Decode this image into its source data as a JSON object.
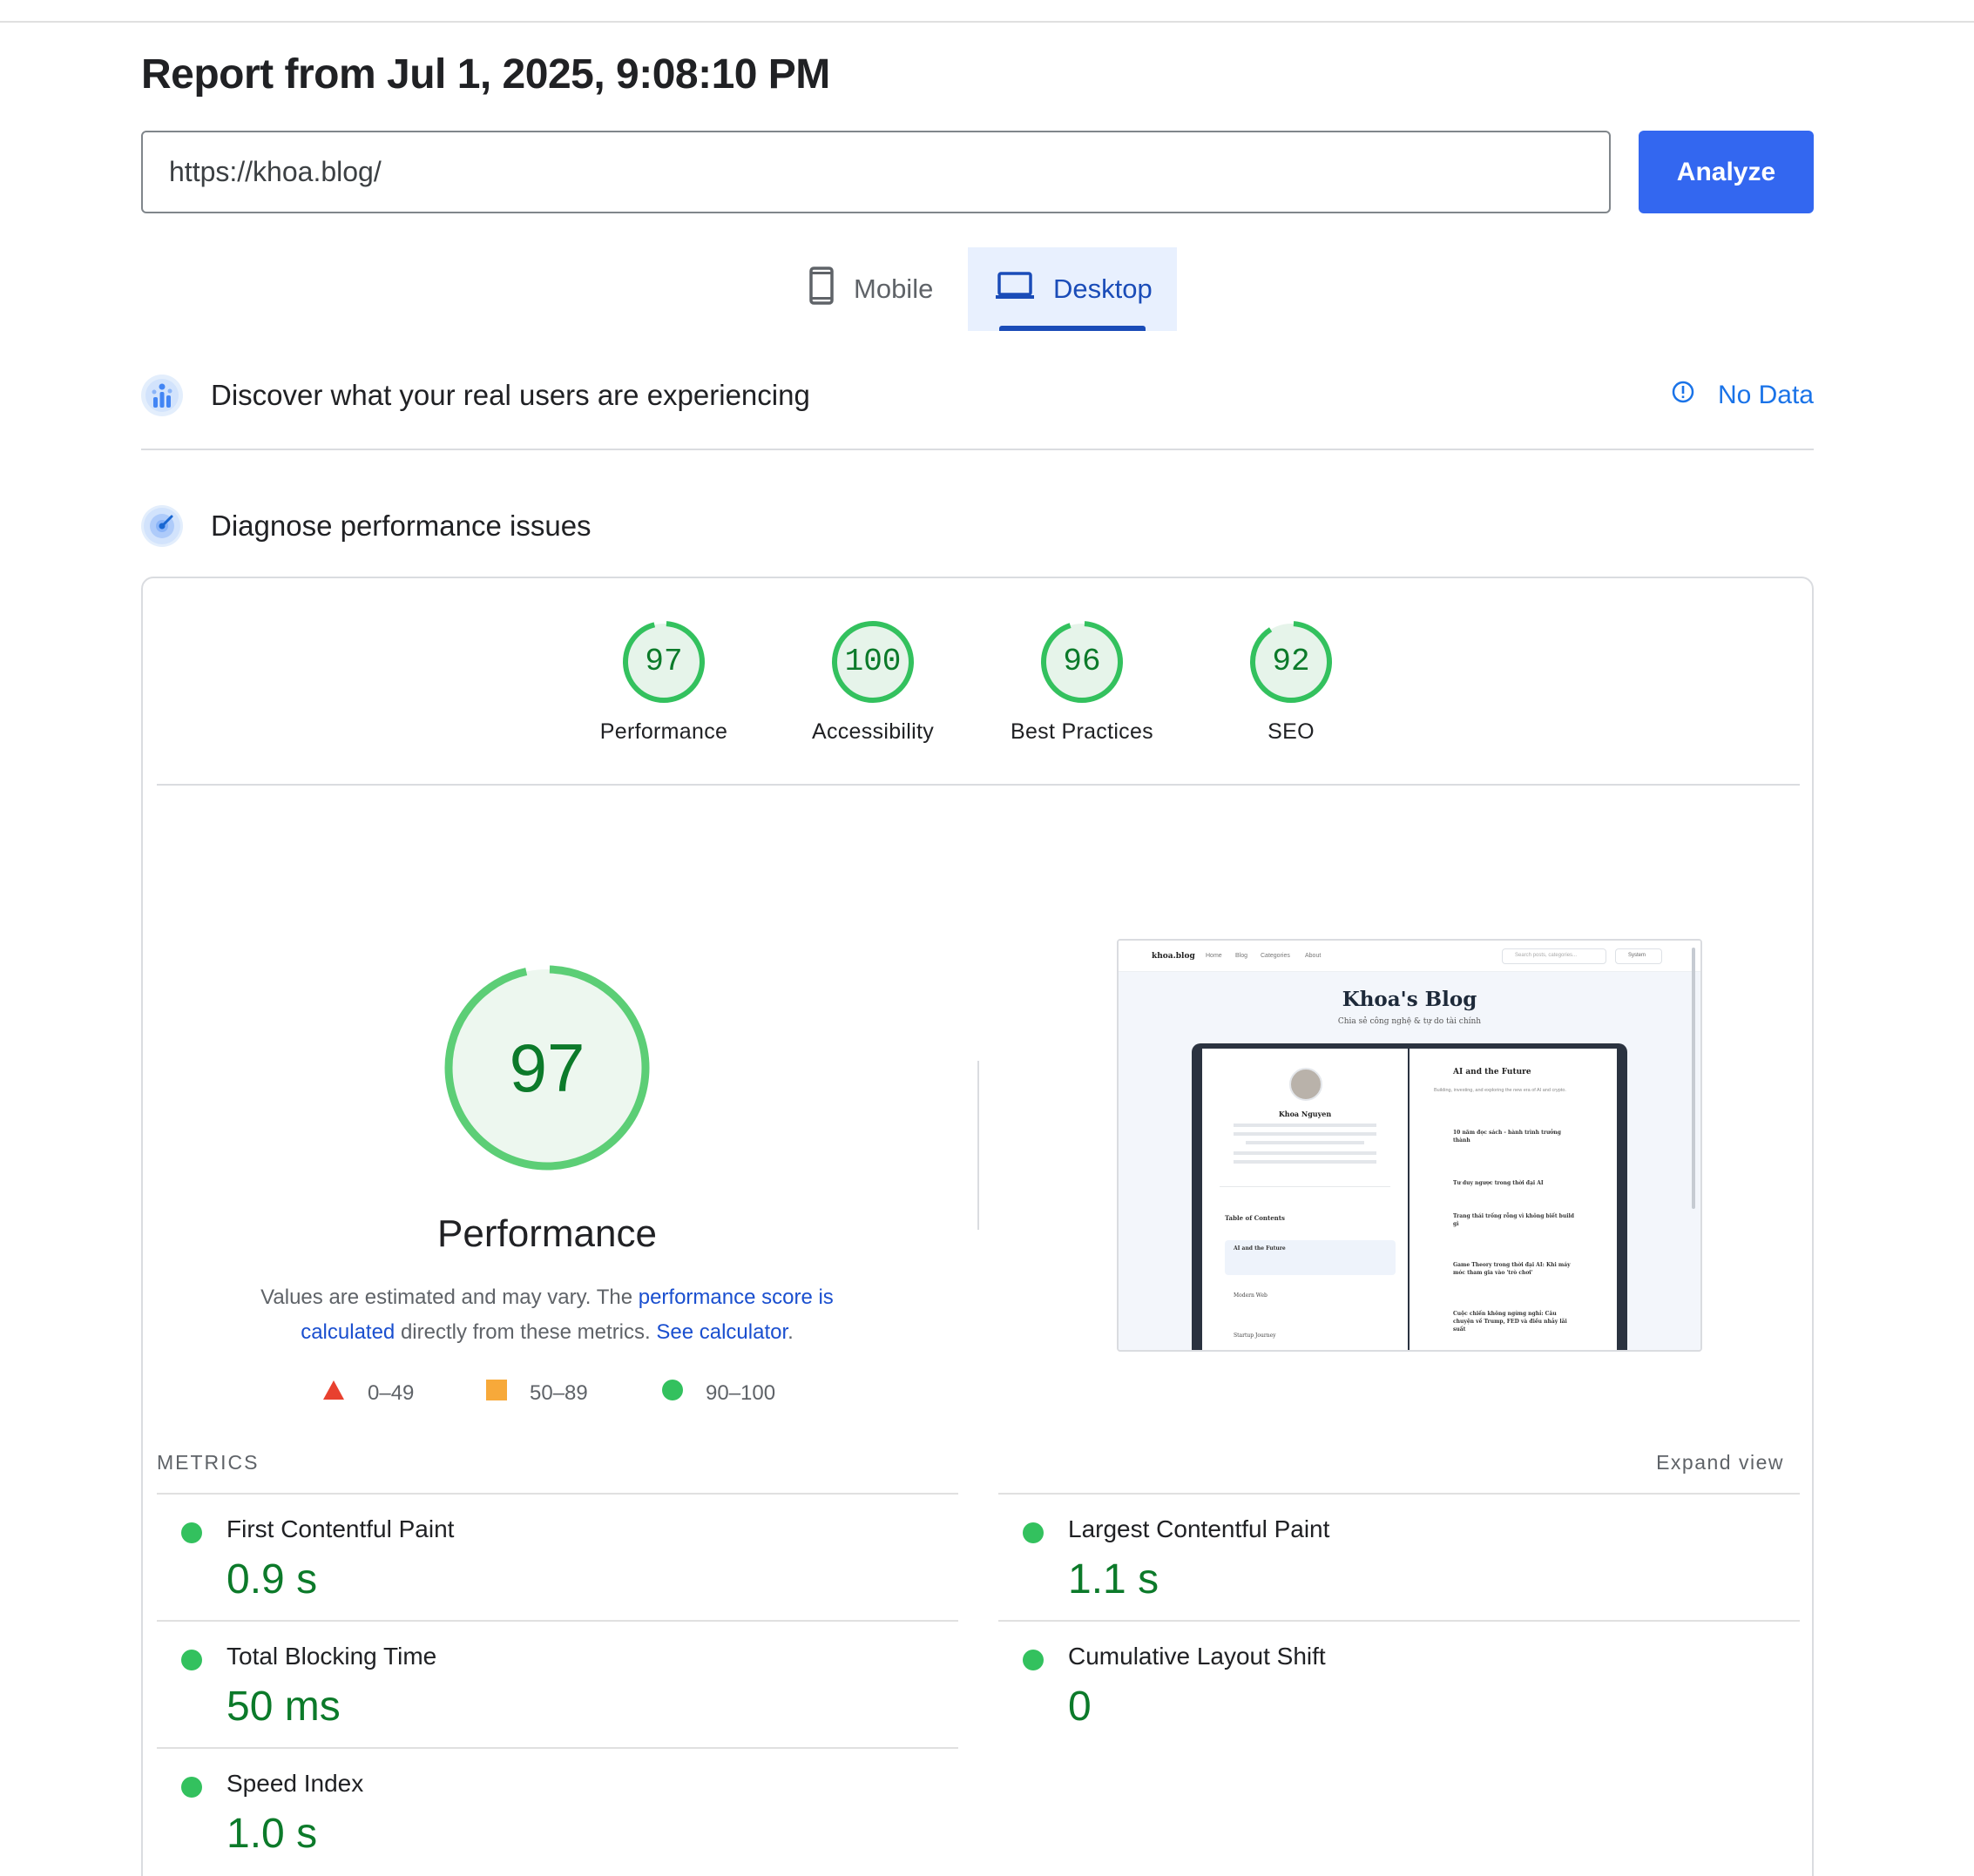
{
  "report": {
    "title": "Report from Jul 1, 2025, 9:08:10 PM"
  },
  "url_field": {
    "value": "https://khoa.blog/"
  },
  "analyze_label": "Analyze",
  "device_tabs": [
    {
      "label": "Mobile",
      "icon": "phone-icon",
      "selected": false
    },
    {
      "label": "Desktop",
      "icon": "laptop-icon",
      "selected": true
    }
  ],
  "real_users": {
    "heading": "Discover what your real users are experiencing",
    "status": "No Data"
  },
  "diagnose": {
    "heading": "Diagnose performance issues"
  },
  "categories": [
    {
      "name": "Performance",
      "score": "97",
      "fraction": 0.97
    },
    {
      "name": "Accessibility",
      "score": "100",
      "fraction": 1.0
    },
    {
      "name": "Best Practices",
      "score": "96",
      "fraction": 0.96
    },
    {
      "name": "SEO",
      "score": "92",
      "fraction": 0.92
    }
  ],
  "performance": {
    "score": "97",
    "fraction": 0.97,
    "label": "Performance",
    "note_prefix": "Values are estimated and may vary. The ",
    "note_link1": "performance score is calculated",
    "note_middle": " directly from these metrics. ",
    "note_link2": "See calculator",
    "note_suffix": "."
  },
  "legend": [
    {
      "shape": "triangle",
      "color": "#e8412f",
      "range": "0–49"
    },
    {
      "shape": "square",
      "color": "#f7a93a",
      "range": "50–89"
    },
    {
      "shape": "circle",
      "color": "#33c15e",
      "range": "90–100"
    }
  ],
  "screenshot": {
    "site_name": "khoa.blog",
    "nav": [
      "Home",
      "Blog",
      "Categories",
      "About"
    ],
    "search_placeholder": "Search posts, categories...",
    "theme": "System",
    "blog_title": "Khoa's Blog",
    "blog_subtitle": "Chia sẻ công nghệ & tự do tài chính",
    "author": "Khoa Nguyen",
    "toc_title": "Table of Contents",
    "toc_items": [
      "AI and the Future",
      "Modern Web",
      "Startup Journey"
    ],
    "section_title": "AI and the Future",
    "section_desc": "Building, investing, and exploring the new era of AI and crypto.",
    "posts": [
      "10 năm đọc sách - hành trình trưởng thành",
      "Tư duy ngược trong thời đại AI",
      "Trang thái trống rỗng vì không biết build gì",
      "Game Theory trong thời đại AI: Khi máy móc tham gia vào 'trò chơi'",
      "Cuộc chiến không ngừng nghỉ: Câu chuyện về Trump, FED và điều nhảy lãi suất"
    ]
  },
  "metrics_section": {
    "title": "METRICS",
    "expand": "Expand view"
  },
  "metrics": [
    {
      "label": "First Contentful Paint",
      "value": "0.9 s"
    },
    {
      "label": "Largest Contentful Paint",
      "value": "1.1 s"
    },
    {
      "label": "Total Blocking Time",
      "value": "50 ms"
    },
    {
      "label": "Cumulative Layout Shift",
      "value": "0"
    },
    {
      "label": "Speed Index",
      "value": "1.0 s"
    }
  ],
  "colors": {
    "accent": "#3367f0",
    "good": "#0c7a2a",
    "good_ring": "#33c15e",
    "good_fill": "#e6f4ea"
  }
}
